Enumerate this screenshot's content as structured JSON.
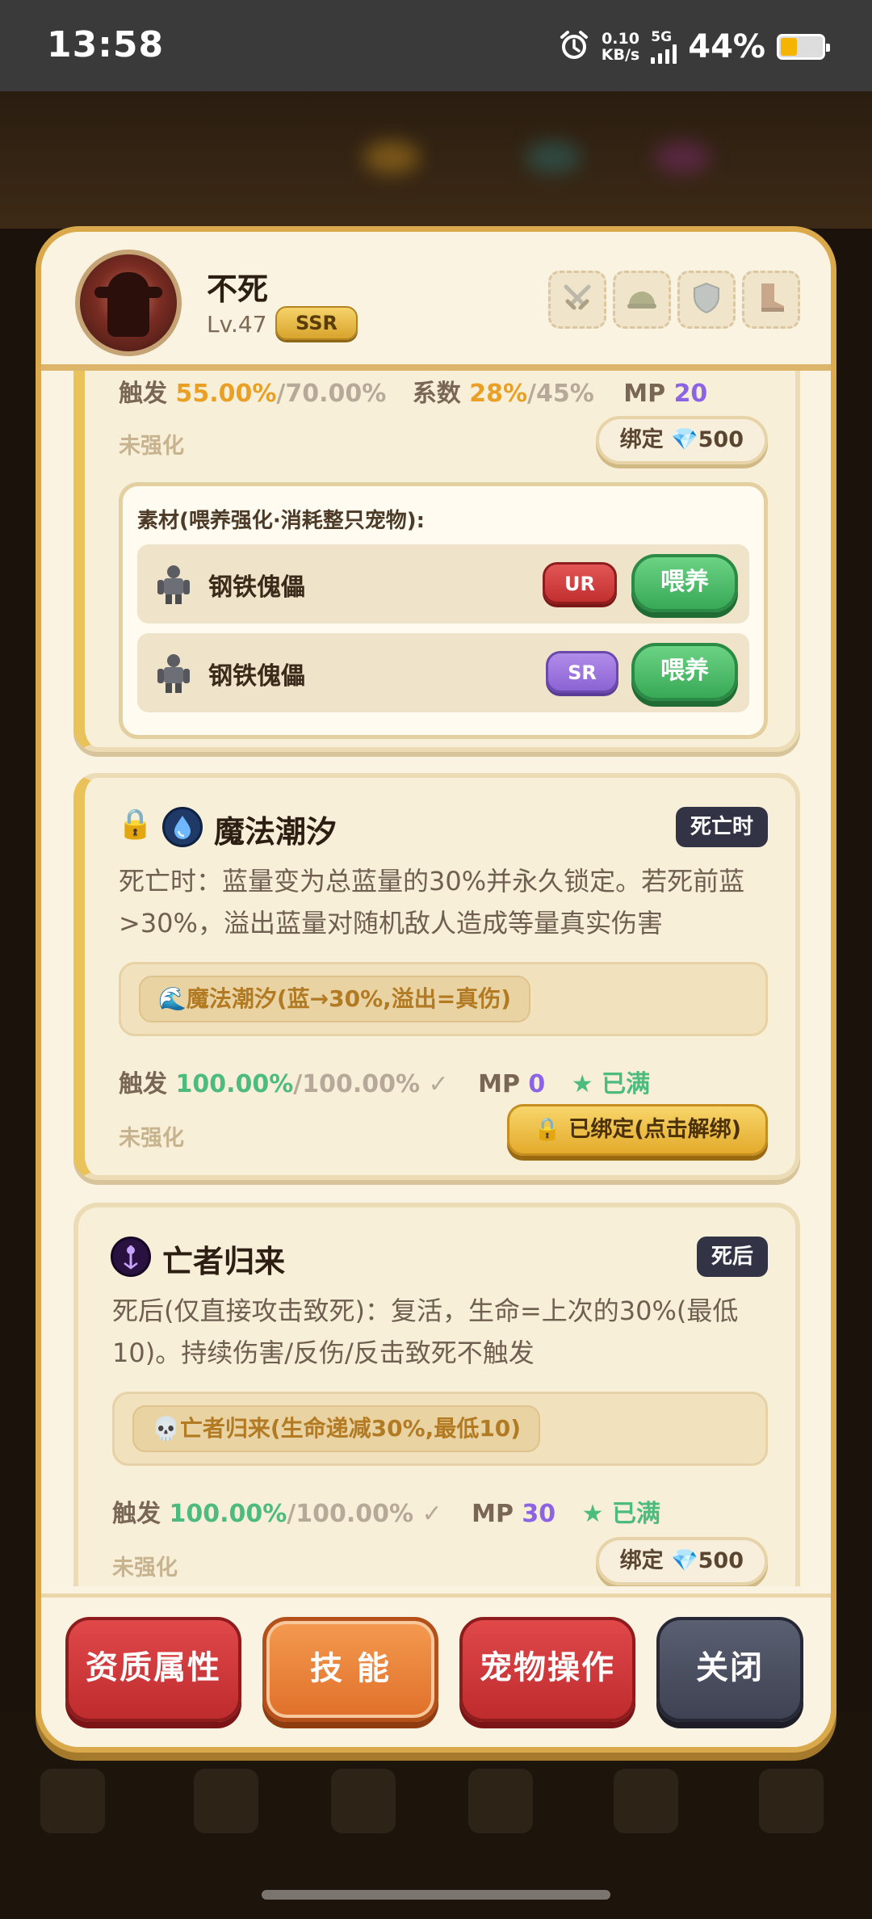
{
  "status_bar": {
    "time": "13:58",
    "net_speed_value": "0.10",
    "net_speed_unit": "KB/s",
    "network": "5G",
    "battery_percent": "44%",
    "battery_level": 0.44,
    "icons": [
      "alarm-icon",
      "signal-icon",
      "battery-icon"
    ]
  },
  "header": {
    "pet_name": "不死",
    "level": "Lv.47",
    "rarity": "SSR",
    "equipment_slots": [
      "sword-icon",
      "helmet-icon",
      "shield-icon",
      "boot-icon"
    ]
  },
  "card1": {
    "trigger_label": "触发",
    "trigger_value": "55.00%",
    "trigger_max": "/70.00%",
    "coef_label": "系数",
    "coef_value": "28%",
    "coef_max": "/45%",
    "mp_label": "MP",
    "mp_value": "20",
    "enhance_status": "未强化",
    "bind_button": "绑定 💎500",
    "materials": {
      "title": "素材(喂养强化·消耗整只宠物):",
      "items": [
        {
          "name": "钢铁傀儡",
          "rarity": "UR",
          "action": "喂养"
        },
        {
          "name": "钢铁傀儡",
          "rarity": "SR",
          "action": "喂养"
        }
      ]
    }
  },
  "card2": {
    "lock_icon": "🔒",
    "title": "魔法潮汐",
    "tag": "死亡时",
    "description": "死亡时：蓝量变为总蓝量的30%并永久锁定。若死前蓝>30%，溢出蓝量对随机敌人造成等量真实伤害",
    "effect": "🌊魔法潮汐(蓝→30%,溢出=真伤)",
    "trigger_label": "触发",
    "trigger_value": "100.00%",
    "trigger_max": "/100.00%",
    "check": "✓",
    "mp_label": "MP",
    "mp_value": "0",
    "full_label": "★ 已满",
    "enhance_status": "未强化",
    "bound_button": "🔒 已绑定(点击解绑)"
  },
  "card3": {
    "title": "亡者归来",
    "tag": "死后",
    "description": "死后(仅直接攻击致死)：复活，生命=上次的30%(最低10)。持续伤害/反伤/反击致死不触发",
    "effect": "💀亡者归来(生命递减30%,最低10)",
    "trigger_label": "触发",
    "trigger_value": "100.00%",
    "trigger_max": "/100.00%",
    "check": "✓",
    "mp_label": "MP",
    "mp_value": "30",
    "full_label": "★ 已满",
    "enhance_status": "未强化",
    "bind_button": "绑定 💎500"
  },
  "footer": {
    "buttons": [
      "资质属性",
      "技 能",
      "宠物操作",
      "关闭"
    ]
  },
  "colors": {
    "frame": "#d9a94b",
    "panel": "#faf3e1",
    "green": "#4dbb7e",
    "purple": "#8b63e4",
    "orange": "#e9a027",
    "red_button": "#c9393b",
    "active_tab": "#e97a34",
    "close_button": "#474b5d"
  }
}
